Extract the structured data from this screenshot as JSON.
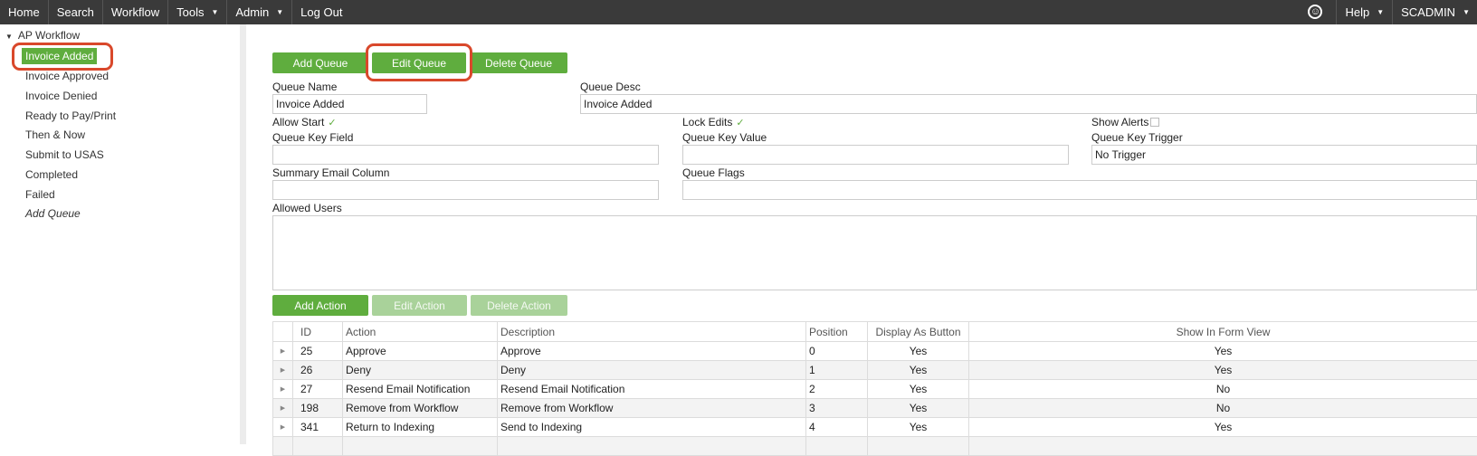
{
  "nav": {
    "left": [
      "Home",
      "Search",
      "Workflow",
      "Tools",
      "Admin",
      "Log Out"
    ],
    "help": "Help",
    "user": "SCADMIN"
  },
  "sidebar": {
    "root": "AP Workflow",
    "items": [
      {
        "label": "Invoice Added",
        "selected": true
      },
      {
        "label": "Invoice Approved"
      },
      {
        "label": "Invoice Denied"
      },
      {
        "label": "Ready to Pay/Print"
      },
      {
        "label": "Then & Now"
      },
      {
        "label": "Submit to USAS"
      },
      {
        "label": "Completed"
      },
      {
        "label": "Failed"
      },
      {
        "label": "Add Queue",
        "italic": true
      }
    ]
  },
  "queue_buttons": {
    "add": "Add Queue",
    "edit": "Edit Queue",
    "delete": "Delete Queue"
  },
  "form": {
    "queue_name_label": "Queue Name",
    "queue_name_value": "Invoice Added",
    "queue_desc_label": "Queue Desc",
    "queue_desc_value": "Invoice Added",
    "allow_start_label": "Allow Start",
    "lock_edits_label": "Lock Edits",
    "show_alerts_label": "Show Alerts",
    "queue_key_field_label": "Queue Key Field",
    "queue_key_value_label": "Queue Key Value",
    "queue_key_trigger_label": "Queue Key Trigger",
    "queue_key_trigger_value": "No Trigger",
    "summary_email_label": "Summary Email Column",
    "queue_flags_label": "Queue Flags",
    "allowed_users_label": "Allowed Users"
  },
  "action_buttons": {
    "add": "Add Action",
    "edit": "Edit Action",
    "delete": "Delete Action"
  },
  "table": {
    "headers": [
      "ID",
      "Action",
      "Description",
      "Position",
      "Display As Button",
      "Show In Form View"
    ],
    "rows": [
      [
        "25",
        "Approve",
        "Approve",
        "0",
        "Yes",
        "Yes"
      ],
      [
        "26",
        "Deny",
        "Deny",
        "1",
        "Yes",
        "Yes"
      ],
      [
        "27",
        "Resend Email Notification",
        "Resend Email Notification",
        "2",
        "Yes",
        "No"
      ],
      [
        "198",
        "Remove from Workflow",
        "Remove from Workflow",
        "3",
        "Yes",
        "No"
      ],
      [
        "341",
        "Return to Indexing",
        "Send to Indexing",
        "4",
        "Yes",
        "Yes"
      ]
    ]
  }
}
